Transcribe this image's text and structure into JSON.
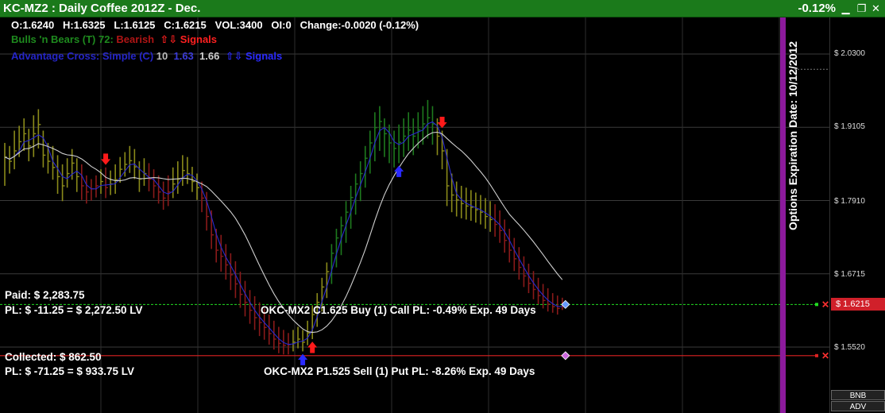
{
  "window": {
    "title": "KC-MZ2 : Daily Coffee 2012Z - Dec.",
    "change_pct": "-0.12%"
  },
  "quote": {
    "open": "O:1.6240",
    "high": "H:1.6325",
    "low": "L:1.6125",
    "close": "C:1.6215",
    "volume": "VOL:3400",
    "oi": "OI:0",
    "change": "Change:-0.0020 (-0.12%)"
  },
  "indicators": [
    {
      "name": "Bulls 'n Bears (T) 72:",
      "state": "Bearish",
      "signals_label": "Signals",
      "name_color": "#1e8a1e",
      "state_color": "#b01515",
      "signals_color": "#ff2020"
    },
    {
      "name": "Advantage Cross: Simple (C)",
      "param1": "10",
      "param2": "1.63",
      "param3": "1.66",
      "signals_label": "Signals",
      "name_color": "#2525c8",
      "signals_color": "#2a2aff"
    }
  ],
  "positions": [
    {
      "label_line1": "Paid: $ 2,283.75",
      "label_line2": "PL: $ -11.25 = $ 2,272.50 LV",
      "detail": "OKC-MX2 C1.625 Buy (1) Call PL: -0.49% Exp. 49 Days",
      "line_color": "#22dd22",
      "marker_color": "#6699ff"
    },
    {
      "label_line1": "Collected: $ 862.50",
      "label_line2": "PL: $ -71.25 = $ 933.75 LV",
      "detail": "OKC-MX2 P1.525 Sell (1) Put PL: -8.26% Exp. 49 Days",
      "line_color": "#dd2222",
      "marker_color": "#cc66dd"
    }
  ],
  "price_axis": {
    "ticks": [
      "$ 2.0300",
      "$ 1.9105",
      "$ 1.7910",
      "$ 1.6715",
      "$ 1.5520"
    ],
    "current": "$ 1.6215"
  },
  "options_expiration": "Options Expiration Date: 10/12/2012",
  "buttons": {
    "bnb": "BNB",
    "adv": "ADV"
  },
  "colors": {
    "title_bar": "#1b7a1b",
    "bull_bar": "#1e7a1e",
    "bear_bar": "#8a1a1a",
    "neutral_bar": "#8a8a1a",
    "fast_ma": "#2a2ad0",
    "slow_ma": "#cfcfcf",
    "expiration_band": "#8c1a9c",
    "current_price_tag": "#d0202a"
  },
  "chart_data": {
    "type": "bar",
    "price_range": [
      1.5,
      2.07
    ],
    "bars": [
      {
        "h": 1.885,
        "l": 1.815,
        "c": 1.862,
        "k": "n"
      },
      {
        "h": 1.88,
        "l": 1.835,
        "c": 1.855,
        "k": "n"
      },
      {
        "h": 1.905,
        "l": 1.842,
        "c": 1.872,
        "k": "n"
      },
      {
        "h": 1.913,
        "l": 1.862,
        "c": 1.887,
        "k": "n"
      },
      {
        "h": 1.925,
        "l": 1.872,
        "c": 1.9,
        "k": "n"
      },
      {
        "h": 1.908,
        "l": 1.855,
        "c": 1.88,
        "k": "n"
      },
      {
        "h": 1.93,
        "l": 1.862,
        "c": 1.9,
        "k": "n"
      },
      {
        "h": 1.94,
        "l": 1.876,
        "c": 1.915,
        "k": "n"
      },
      {
        "h": 1.905,
        "l": 1.845,
        "c": 1.865,
        "k": "n"
      },
      {
        "h": 1.885,
        "l": 1.835,
        "c": 1.855,
        "k": "n"
      },
      {
        "h": 1.88,
        "l": 1.825,
        "c": 1.845,
        "k": "n"
      },
      {
        "h": 1.865,
        "l": 1.802,
        "c": 1.83,
        "k": "n"
      },
      {
        "h": 1.85,
        "l": 1.79,
        "c": 1.815,
        "k": "n"
      },
      {
        "h": 1.86,
        "l": 1.812,
        "c": 1.835,
        "k": "n"
      },
      {
        "h": 1.875,
        "l": 1.825,
        "c": 1.852,
        "k": "n"
      },
      {
        "h": 1.86,
        "l": 1.805,
        "c": 1.83,
        "k": "n"
      },
      {
        "h": 1.85,
        "l": 1.792,
        "c": 1.815,
        "k": "d"
      },
      {
        "h": 1.832,
        "l": 1.786,
        "c": 1.805,
        "k": "d"
      },
      {
        "h": 1.826,
        "l": 1.791,
        "c": 1.81,
        "k": "d"
      },
      {
        "h": 1.832,
        "l": 1.796,
        "c": 1.815,
        "k": "d"
      },
      {
        "h": 1.842,
        "l": 1.802,
        "c": 1.822,
        "k": "n"
      },
      {
        "h": 1.845,
        "l": 1.795,
        "c": 1.812,
        "k": "d"
      },
      {
        "h": 1.84,
        "l": 1.8,
        "c": 1.818,
        "k": "n"
      },
      {
        "h": 1.85,
        "l": 1.802,
        "c": 1.825,
        "k": "n"
      },
      {
        "h": 1.862,
        "l": 1.82,
        "c": 1.842,
        "k": "n"
      },
      {
        "h": 1.87,
        "l": 1.83,
        "c": 1.85,
        "k": "n"
      },
      {
        "h": 1.88,
        "l": 1.836,
        "c": 1.856,
        "k": "n"
      },
      {
        "h": 1.875,
        "l": 1.826,
        "c": 1.846,
        "k": "n"
      },
      {
        "h": 1.855,
        "l": 1.805,
        "c": 1.826,
        "k": "n"
      },
      {
        "h": 1.86,
        "l": 1.815,
        "c": 1.835,
        "k": "n"
      },
      {
        "h": 1.852,
        "l": 1.806,
        "c": 1.826,
        "k": "d"
      },
      {
        "h": 1.842,
        "l": 1.795,
        "c": 1.815,
        "k": "d"
      },
      {
        "h": 1.832,
        "l": 1.786,
        "c": 1.805,
        "k": "d"
      },
      {
        "h": 1.822,
        "l": 1.776,
        "c": 1.795,
        "k": "d"
      },
      {
        "h": 1.832,
        "l": 1.782,
        "c": 1.805,
        "k": "d"
      },
      {
        "h": 1.845,
        "l": 1.795,
        "c": 1.818,
        "k": "n"
      },
      {
        "h": 1.855,
        "l": 1.802,
        "c": 1.826,
        "k": "n"
      },
      {
        "h": 1.865,
        "l": 1.815,
        "c": 1.84,
        "k": "n"
      },
      {
        "h": 1.862,
        "l": 1.818,
        "c": 1.835,
        "k": "n"
      },
      {
        "h": 1.846,
        "l": 1.805,
        "c": 1.822,
        "k": "n"
      },
      {
        "h": 1.835,
        "l": 1.792,
        "c": 1.812,
        "k": "n"
      },
      {
        "h": 1.822,
        "l": 1.772,
        "c": 1.795,
        "k": "d"
      },
      {
        "h": 1.805,
        "l": 1.742,
        "c": 1.765,
        "k": "d"
      },
      {
        "h": 1.775,
        "l": 1.712,
        "c": 1.735,
        "k": "d"
      },
      {
        "h": 1.745,
        "l": 1.69,
        "c": 1.71,
        "k": "d"
      },
      {
        "h": 1.735,
        "l": 1.675,
        "c": 1.7,
        "k": "d"
      },
      {
        "h": 1.72,
        "l": 1.662,
        "c": 1.686,
        "k": "d"
      },
      {
        "h": 1.705,
        "l": 1.645,
        "c": 1.67,
        "k": "d"
      },
      {
        "h": 1.692,
        "l": 1.632,
        "c": 1.655,
        "k": "d"
      },
      {
        "h": 1.675,
        "l": 1.616,
        "c": 1.638,
        "k": "d"
      },
      {
        "h": 1.66,
        "l": 1.602,
        "c": 1.625,
        "k": "d"
      },
      {
        "h": 1.645,
        "l": 1.59,
        "c": 1.612,
        "k": "d"
      },
      {
        "h": 1.635,
        "l": 1.58,
        "c": 1.6,
        "k": "d"
      },
      {
        "h": 1.625,
        "l": 1.57,
        "c": 1.592,
        "k": "d"
      },
      {
        "h": 1.615,
        "l": 1.564,
        "c": 1.584,
        "k": "d"
      },
      {
        "h": 1.605,
        "l": 1.556,
        "c": 1.574,
        "k": "d"
      },
      {
        "h": 1.595,
        "l": 1.548,
        "c": 1.565,
        "k": "d"
      },
      {
        "h": 1.585,
        "l": 1.542,
        "c": 1.558,
        "k": "d"
      },
      {
        "h": 1.58,
        "l": 1.54,
        "c": 1.555,
        "k": "d"
      },
      {
        "h": 1.575,
        "l": 1.54,
        "c": 1.556,
        "k": "d"
      },
      {
        "h": 1.58,
        "l": 1.545,
        "c": 1.56,
        "k": "n"
      },
      {
        "h": 1.585,
        "l": 1.55,
        "c": 1.565,
        "k": "n"
      },
      {
        "h": 1.58,
        "l": 1.545,
        "c": 1.56,
        "k": "n"
      },
      {
        "h": 1.595,
        "l": 1.555,
        "c": 1.575,
        "k": "n"
      },
      {
        "h": 1.62,
        "l": 1.565,
        "c": 1.605,
        "k": "n"
      },
      {
        "h": 1.64,
        "l": 1.585,
        "c": 1.625,
        "k": "n"
      },
      {
        "h": 1.665,
        "l": 1.61,
        "c": 1.65,
        "k": "n"
      },
      {
        "h": 1.69,
        "l": 1.632,
        "c": 1.675,
        "k": "n"
      },
      {
        "h": 1.72,
        "l": 1.655,
        "c": 1.705,
        "k": "u"
      },
      {
        "h": 1.745,
        "l": 1.682,
        "c": 1.73,
        "k": "u"
      },
      {
        "h": 1.765,
        "l": 1.702,
        "c": 1.75,
        "k": "u"
      },
      {
        "h": 1.79,
        "l": 1.722,
        "c": 1.772,
        "k": "u"
      },
      {
        "h": 1.815,
        "l": 1.745,
        "c": 1.796,
        "k": "u"
      },
      {
        "h": 1.835,
        "l": 1.768,
        "c": 1.818,
        "k": "u"
      },
      {
        "h": 1.855,
        "l": 1.79,
        "c": 1.835,
        "k": "u"
      },
      {
        "h": 1.88,
        "l": 1.812,
        "c": 1.86,
        "k": "u"
      },
      {
        "h": 1.905,
        "l": 1.835,
        "c": 1.885,
        "k": "u"
      },
      {
        "h": 1.935,
        "l": 1.855,
        "c": 1.91,
        "k": "u"
      },
      {
        "h": 1.945,
        "l": 1.872,
        "c": 1.92,
        "k": "u"
      },
      {
        "h": 1.925,
        "l": 1.862,
        "c": 1.9,
        "k": "u"
      },
      {
        "h": 1.915,
        "l": 1.852,
        "c": 1.885,
        "k": "u"
      },
      {
        "h": 1.905,
        "l": 1.845,
        "c": 1.876,
        "k": "u"
      },
      {
        "h": 1.915,
        "l": 1.852,
        "c": 1.886,
        "k": "u"
      },
      {
        "h": 1.925,
        "l": 1.862,
        "c": 1.896,
        "k": "u"
      },
      {
        "h": 1.935,
        "l": 1.872,
        "c": 1.906,
        "k": "u"
      },
      {
        "h": 1.925,
        "l": 1.865,
        "c": 1.896,
        "k": "u"
      },
      {
        "h": 1.935,
        "l": 1.876,
        "c": 1.906,
        "k": "u"
      },
      {
        "h": 1.945,
        "l": 1.882,
        "c": 1.916,
        "k": "u"
      },
      {
        "h": 1.955,
        "l": 1.892,
        "c": 1.926,
        "k": "u"
      },
      {
        "h": 1.945,
        "l": 1.882,
        "c": 1.916,
        "k": "u"
      },
      {
        "h": 1.925,
        "l": 1.865,
        "c": 1.896,
        "k": "n"
      },
      {
        "h": 1.905,
        "l": 1.842,
        "c": 1.872,
        "k": "n"
      },
      {
        "h": 1.875,
        "l": 1.782,
        "c": 1.815,
        "k": "n"
      },
      {
        "h": 1.835,
        "l": 1.772,
        "c": 1.8,
        "k": "n"
      },
      {
        "h": 1.822,
        "l": 1.765,
        "c": 1.792,
        "k": "n"
      },
      {
        "h": 1.815,
        "l": 1.762,
        "c": 1.786,
        "k": "n"
      },
      {
        "h": 1.812,
        "l": 1.76,
        "c": 1.782,
        "k": "n"
      },
      {
        "h": 1.808,
        "l": 1.758,
        "c": 1.78,
        "k": "n"
      },
      {
        "h": 1.804,
        "l": 1.755,
        "c": 1.776,
        "k": "n"
      },
      {
        "h": 1.8,
        "l": 1.752,
        "c": 1.772,
        "k": "n"
      },
      {
        "h": 1.795,
        "l": 1.745,
        "c": 1.765,
        "k": "n"
      },
      {
        "h": 1.79,
        "l": 1.74,
        "c": 1.76,
        "k": "n"
      },
      {
        "h": 1.785,
        "l": 1.732,
        "c": 1.752,
        "k": "d"
      },
      {
        "h": 1.775,
        "l": 1.722,
        "c": 1.742,
        "k": "d"
      },
      {
        "h": 1.76,
        "l": 1.706,
        "c": 1.726,
        "k": "d"
      },
      {
        "h": 1.745,
        "l": 1.69,
        "c": 1.71,
        "k": "d"
      },
      {
        "h": 1.73,
        "l": 1.676,
        "c": 1.696,
        "k": "d"
      },
      {
        "h": 1.715,
        "l": 1.662,
        "c": 1.682,
        "k": "d"
      },
      {
        "h": 1.7,
        "l": 1.65,
        "c": 1.668,
        "k": "d"
      },
      {
        "h": 1.688,
        "l": 1.64,
        "c": 1.656,
        "k": "d"
      },
      {
        "h": 1.676,
        "l": 1.63,
        "c": 1.646,
        "k": "d"
      },
      {
        "h": 1.665,
        "l": 1.622,
        "c": 1.636,
        "k": "d"
      },
      {
        "h": 1.655,
        "l": 1.615,
        "c": 1.628,
        "k": "d"
      },
      {
        "h": 1.648,
        "l": 1.61,
        "c": 1.622,
        "k": "d"
      },
      {
        "h": 1.64,
        "l": 1.608,
        "c": 1.618,
        "k": "d"
      },
      {
        "h": 1.636,
        "l": 1.605,
        "c": 1.615,
        "k": "d"
      },
      {
        "h": 1.6325,
        "l": 1.6125,
        "c": 1.6215,
        "k": "d"
      }
    ],
    "signals": [
      {
        "bar": 21,
        "dir": "down",
        "color": "red"
      },
      {
        "bar": 64,
        "dir": "up",
        "color": "red"
      },
      {
        "bar": 62,
        "dir": "up",
        "color": "blue"
      },
      {
        "bar": 82,
        "dir": "up",
        "color": "blue"
      },
      {
        "bar": 91,
        "dir": "down",
        "color": "red"
      }
    ],
    "horizontal_lines": [
      {
        "price": 1.6215,
        "color": "green",
        "dash": true
      },
      {
        "price": 1.538,
        "color": "red",
        "dash": false
      }
    ],
    "expiration_bar_index": 139
  }
}
